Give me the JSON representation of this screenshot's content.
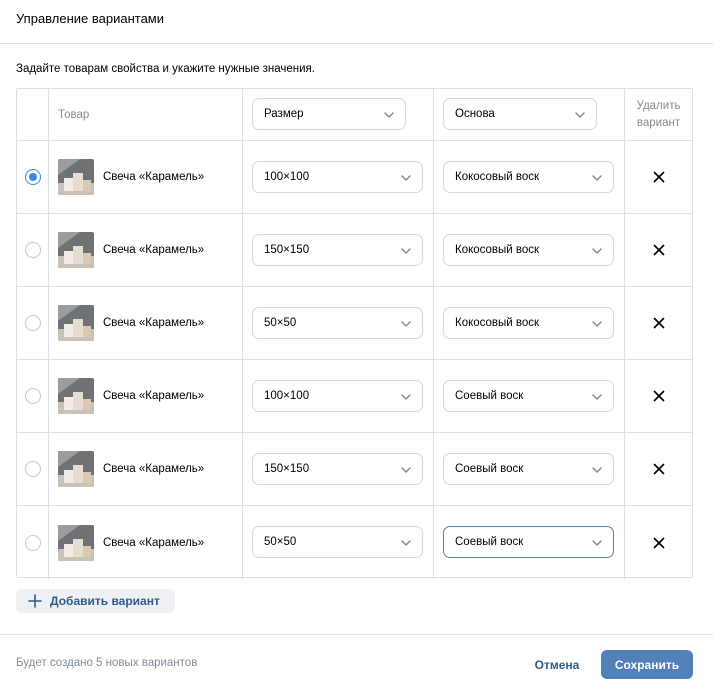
{
  "dialog": {
    "title": "Управление вариантами",
    "hint": "Задайте товарам свойства и укажите нужные значения."
  },
  "table": {
    "header": {
      "product": "Товар",
      "size_select": "Размер",
      "base_select": "Основа",
      "delete": "Удалить вариант"
    },
    "rows": [
      {
        "selected": true,
        "name": "Свеча «Карамель»",
        "size": "100×100",
        "base": "Кокосовый воск"
      },
      {
        "selected": false,
        "name": "Свеча «Карамель»",
        "size": "150×150",
        "base": "Кокосовый воск"
      },
      {
        "selected": false,
        "name": "Свеча «Карамель»",
        "size": "50×50",
        "base": "Кокосовый воск"
      },
      {
        "selected": false,
        "name": "Свеча «Карамель»",
        "size": "100×100",
        "base": "Соевый воск"
      },
      {
        "selected": false,
        "name": "Свеча «Карамель»",
        "size": "150×150",
        "base": "Соевый воск"
      },
      {
        "selected": false,
        "name": "Свеча «Карамель»",
        "size": "50×50",
        "base": "Соевый воск",
        "focused": true
      }
    ]
  },
  "add_variant_label": "Добавить вариант",
  "footer": {
    "note": "Будет создано 5 новых вариантов",
    "cancel": "Отмена",
    "save": "Сохранить"
  },
  "icons": {
    "dropdown": "chevron-down-icon",
    "delete": "close-icon",
    "add": "plus-icon"
  },
  "colors": {
    "accent": "#5181b8",
    "link": "#2d5c8a",
    "muted": "#818c99",
    "radio": "#3f8ae0"
  }
}
